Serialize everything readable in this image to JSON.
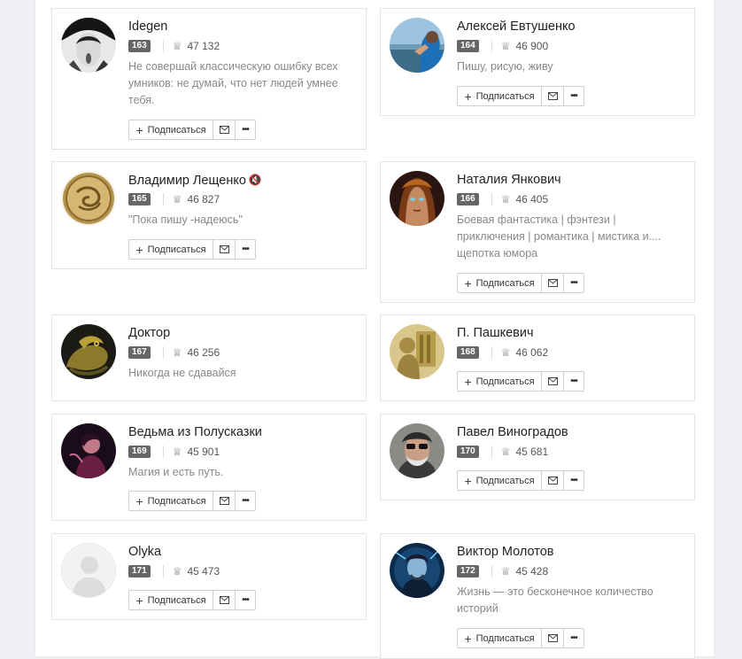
{
  "cards": [
    {
      "name": "Idegen",
      "rank": "163",
      "rating": "47 132",
      "bio": "Не совершай классическую ошибку всех умников: не думай, что нет людей умнее тебя.",
      "muted": false
    },
    {
      "name": "Алексей Евтушенко",
      "rank": "164",
      "rating": "46 900",
      "bio": "Пишу, рисую, живу",
      "muted": false
    },
    {
      "name": "Владимир Лещенко",
      "rank": "165",
      "rating": "46 827",
      "bio": "\"Пока пишу -надеюсь\"",
      "muted": true
    },
    {
      "name": "Наталия Янкович",
      "rank": "166",
      "rating": "46 405",
      "bio": "Боевая фантастика | фэнтези | приключения | романтика | мистика и.... щепотка юмора",
      "muted": false
    },
    {
      "name": "Доктор",
      "rank": "167",
      "rating": "46 256",
      "bio": "Никогда не сдавайся",
      "muted": false
    },
    {
      "name": "П. Пашкевич",
      "rank": "168",
      "rating": "46 062",
      "bio": "",
      "muted": false
    },
    {
      "name": "Ведьма из Полусказки",
      "rank": "169",
      "rating": "45 901",
      "bio": "Магия и есть путь.",
      "muted": false
    },
    {
      "name": "Павел Виноградов",
      "rank": "170",
      "rating": "45 681",
      "bio": "",
      "muted": false
    },
    {
      "name": "Olyka",
      "rank": "171",
      "rating": "45 473",
      "bio": "",
      "muted": false
    },
    {
      "name": "Виктор Молотов",
      "rank": "172",
      "rating": "45 428",
      "bio": "Жизнь — это бесконечное количество историй",
      "muted": false
    }
  ],
  "labels": {
    "subscribe": "Подписаться",
    "muted_icon": "volume-mute-icon",
    "rating_icon": "crown-icon",
    "mail_icon": "envelope-icon",
    "more_icon": "ellipsis-icon"
  },
  "colors": {
    "rank_badge": "#666666",
    "bio_text": "#888888"
  }
}
